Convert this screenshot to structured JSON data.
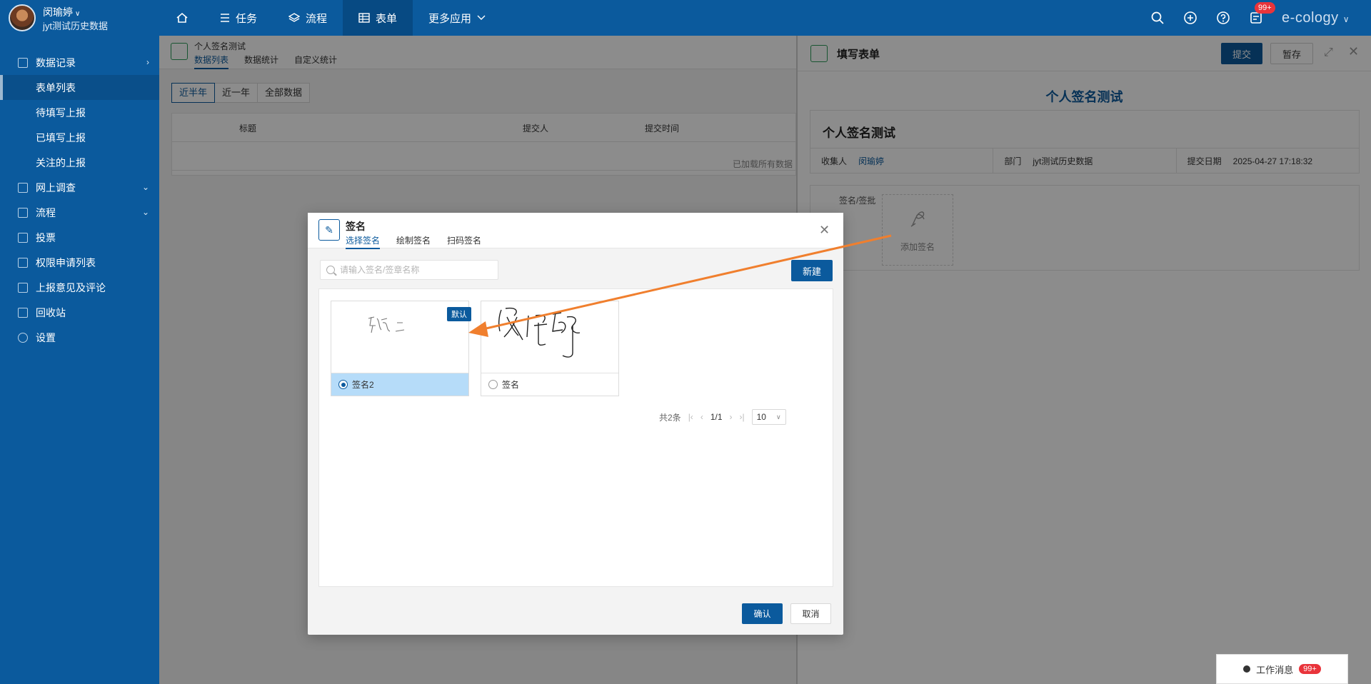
{
  "topbar": {
    "user_name": "闵瑜婷",
    "user_dept": "jyt测试历史数据",
    "nav": [
      {
        "label": "",
        "icon": "home-icon"
      },
      {
        "label": "任务",
        "icon": "list-icon"
      },
      {
        "label": "流程",
        "icon": "layers-icon"
      },
      {
        "label": "表单",
        "icon": "table-icon"
      },
      {
        "label": "更多应用",
        "icon": "chevron-down-icon"
      }
    ],
    "notify_badge": "99+",
    "brand": "e-cology"
  },
  "sidebar": {
    "items": [
      {
        "label": "数据记录"
      },
      {
        "label": "表单列表"
      },
      {
        "label": "待填写上报"
      },
      {
        "label": "已填写上报"
      },
      {
        "label": "关注的上报"
      },
      {
        "label": "网上调查"
      },
      {
        "label": "流程"
      },
      {
        "label": "投票"
      },
      {
        "label": "权限申请列表"
      },
      {
        "label": "上报意见及评论"
      },
      {
        "label": "回收站"
      },
      {
        "label": "设置"
      }
    ]
  },
  "main": {
    "title": "个人签名测试",
    "tabs": [
      "数据列表",
      "数据统计",
      "自定义统计"
    ],
    "filters": [
      "近半年",
      "近一年",
      "全部数据"
    ],
    "columns": [
      "标题",
      "提交人",
      "提交时间"
    ],
    "footer": "已加载所有数据"
  },
  "rpanel": {
    "title": "填写表单",
    "submit": "提交",
    "save": "暂存",
    "form_title": "个人签名测试",
    "box_title": "个人签名测试",
    "collector_label": "收集人",
    "collector": "闵瑜婷",
    "dept_label": "部门",
    "dept": "jyt测试历史数据",
    "date_label": "提交日期",
    "date": "2025-04-27 17:18:32",
    "sig_label": "签名/签批",
    "sig_add": "添加签名"
  },
  "work_msg": {
    "label": "工作消息",
    "badge": "99+"
  },
  "dialog": {
    "title": "签名",
    "tabs": [
      "选择签名",
      "绘制签名",
      "扫码签名"
    ],
    "search_placeholder": "请输入签名/签章名称",
    "new_btn": "新建",
    "cards": [
      {
        "name": "签名2",
        "default_tag": "默认",
        "selected": true
      },
      {
        "name": "签名",
        "selected": false
      }
    ],
    "pager": {
      "total": "共2条",
      "page": "1/1",
      "size": "10"
    },
    "ok": "确认",
    "cancel": "取消"
  },
  "colors": {
    "primary": "#0b5a9d",
    "accent_arrow": "#f07f2e",
    "badge": "#e9343b"
  }
}
